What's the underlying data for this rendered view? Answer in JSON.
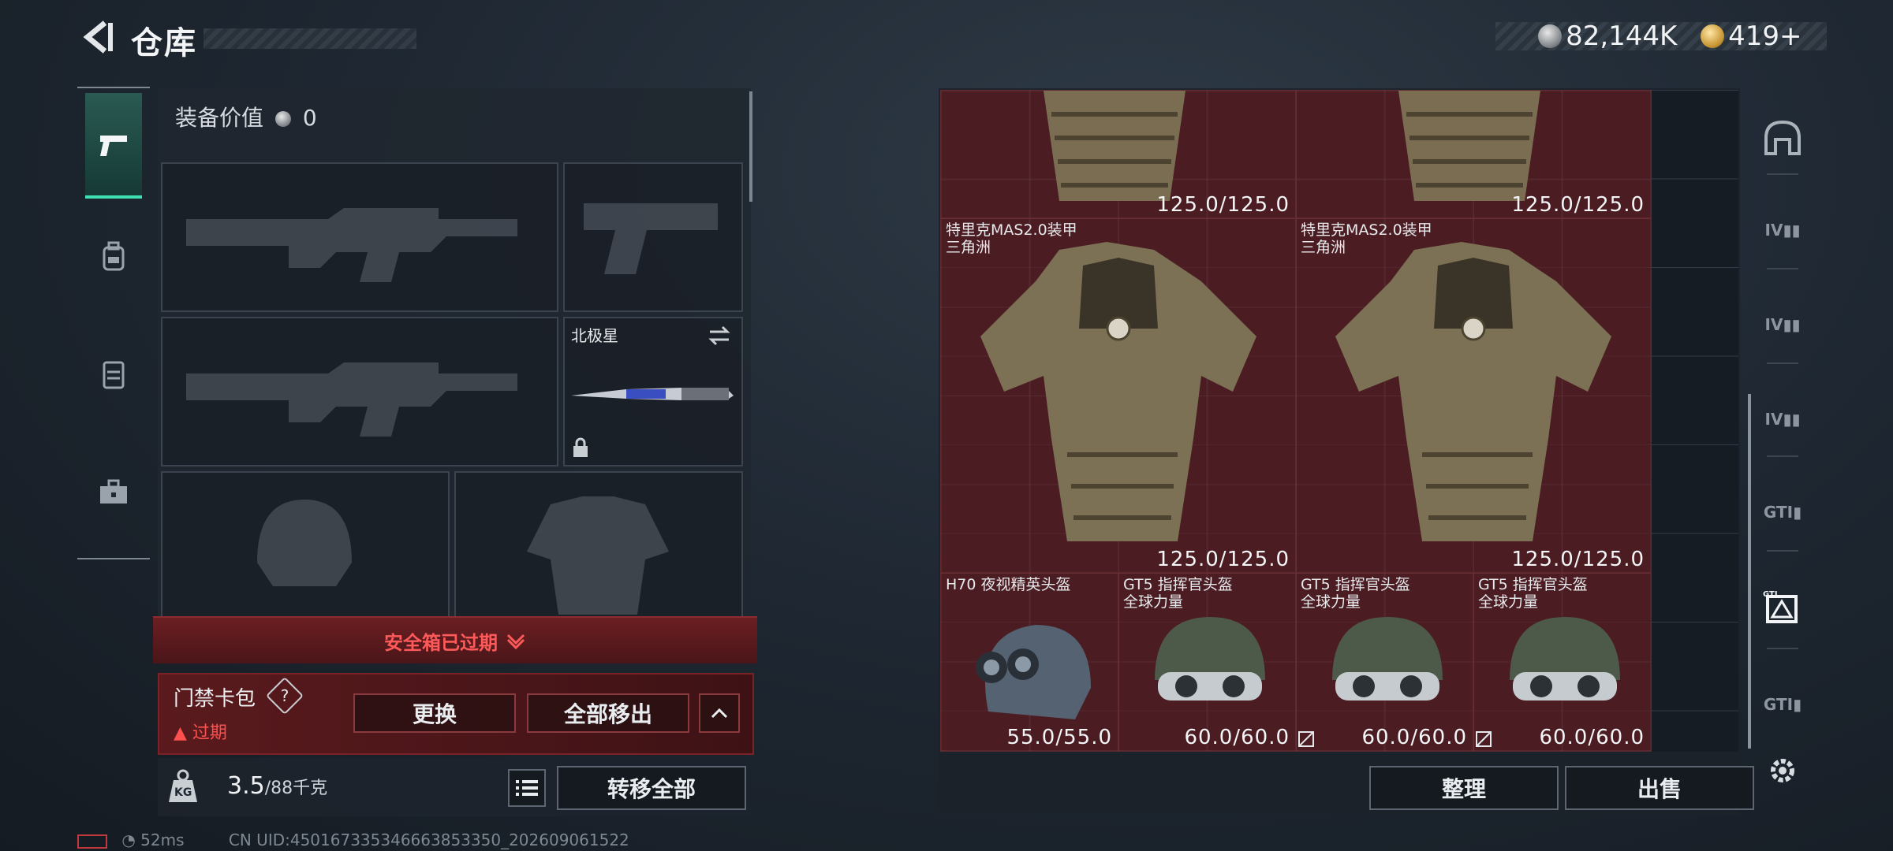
{
  "header": {
    "title": "仓库",
    "currencies": [
      {
        "icon": "silver-coin-icon",
        "value": "82,144K"
      },
      {
        "icon": "gold-coin-icon",
        "value": "419+"
      }
    ]
  },
  "left_tabs": [
    {
      "name": "pistol-icon",
      "active": true
    },
    {
      "name": "backpack-icon",
      "active": false
    },
    {
      "name": "chest-rig-icon",
      "active": false
    },
    {
      "name": "toolbox-icon",
      "active": false
    }
  ],
  "loadout": {
    "value_label": "装备价值",
    "value": "0",
    "melee_name": "北极星"
  },
  "safe_box": {
    "banner": "安全箱已过期",
    "card_title": "门禁卡包",
    "help": "?",
    "expired_text": "过期",
    "replace_label": "更换",
    "remove_all_label": "全部移出"
  },
  "weight": {
    "current": "3.5",
    "max_text": "/88千克",
    "icon_label": "KG",
    "transfer_all_label": "转移全部"
  },
  "status": {
    "ping": "52ms",
    "uid": "CN UID:450167335346663853350_202609061522"
  },
  "stash_items": [
    {
      "name": "",
      "durability": "125.0/125.0"
    },
    {
      "name": "",
      "durability": "125.0/125.0"
    },
    {
      "name": "特里克MAS2.0装甲\n三角洲",
      "durability": "125.0/125.0"
    },
    {
      "name": "特里克MAS2.0装甲\n三角洲",
      "durability": "125.0/125.0"
    },
    {
      "name": "H70 夜视精英头盔",
      "durability": "55.0/55.0"
    },
    {
      "name": "GT5 指挥官头盔\n全球力量",
      "durability": "60.0/60.0"
    },
    {
      "name": "GT5 指挥官头盔\n全球力量",
      "durability": "60.0/60.0"
    },
    {
      "name": "GT5 指挥官头盔\n全球力量",
      "durability": "60.0/60.0"
    }
  ],
  "stash_buttons": {
    "sort_label": "整理",
    "sell_label": "出售"
  },
  "side_filters": [
    {
      "name": "helmet-filter-icon",
      "label": ""
    },
    {
      "name": "armor-iv-filter-icon",
      "label": "IV"
    },
    {
      "name": "armor-iv-filter-icon",
      "label": "IV"
    },
    {
      "name": "armor-iv-filter-icon",
      "label": "IV"
    },
    {
      "name": "gti-filter-icon",
      "label": "GTI"
    },
    {
      "name": "gti-active-filter-icon",
      "label": "GTI"
    },
    {
      "name": "gti-filter-icon",
      "label": "GTI"
    }
  ],
  "colors": {
    "accent_green": "#3fe0b1",
    "alert_red": "#ff5050",
    "item_bg_red": "#601e24"
  }
}
